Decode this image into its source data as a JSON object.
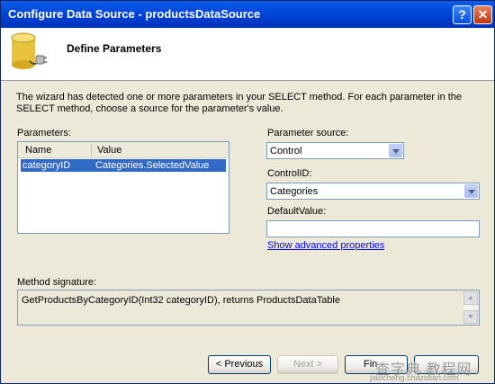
{
  "window": {
    "title": "Configure Data Source - productsDataSource"
  },
  "titlebar": {
    "help_label": "?",
    "close_label": "✕"
  },
  "header": {
    "title": "Define Parameters",
    "icon": "database-plug-icon"
  },
  "intro": "The wizard has detected one or more parameters in your SELECT method. For each parameter in the SELECT method, choose a source for the parameter's value.",
  "parameters": {
    "label": "Parameters:",
    "columns": [
      "Name",
      "Value"
    ],
    "rows": [
      {
        "name": "categoryID",
        "value": "Categories.SelectedValue"
      }
    ]
  },
  "parameter_source": {
    "label": "Parameter source:",
    "value": "Control"
  },
  "control_id": {
    "label": "ControlID:",
    "value": "Categories"
  },
  "default_value": {
    "label": "DefaultValue:",
    "value": ""
  },
  "advanced_link": "Show advanced properties",
  "method_signature": {
    "label": "Method signature:",
    "value": "GetProductsByCategoryID(Int32 categoryID), returns ProductsDataTable"
  },
  "buttons": {
    "previous": "< Previous",
    "next": "Next >",
    "finish": "Fin"
  },
  "watermark": {
    "main": "查字典 教程网",
    "sub": "jiaocheng.chazidian.com"
  },
  "colors": {
    "selection": "#316ac5",
    "titlebar": "#0041d6",
    "link": "#0000ff"
  }
}
